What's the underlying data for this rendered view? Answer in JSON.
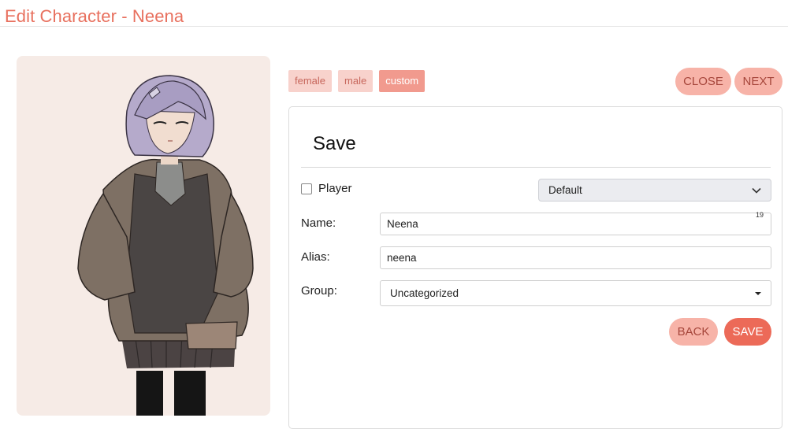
{
  "header": {
    "title": "Edit Character - Neena"
  },
  "tabs": [
    {
      "label": "female",
      "active": false
    },
    {
      "label": "male",
      "active": false
    },
    {
      "label": "custom",
      "active": true
    }
  ],
  "top_actions": {
    "close_label": "CLOSE",
    "next_label": "NEXT"
  },
  "card": {
    "title": "Save",
    "player": {
      "label": "Player",
      "checked": false
    },
    "preset_select": {
      "value": "Default"
    },
    "name": {
      "label": "Name:",
      "value": "Neena",
      "counter": "19"
    },
    "alias": {
      "label": "Alias:",
      "value": "neena"
    },
    "group": {
      "label": "Group:",
      "value": "Uncategorized"
    },
    "actions": {
      "back_label": "BACK",
      "save_label": "SAVE"
    }
  },
  "portrait": {
    "subject": "character-illustration"
  },
  "colors": {
    "accent": "#ec6a58",
    "title": "#e8705e",
    "tab_bg": "#f8d2cc",
    "tab_active_bg": "#f19a8e",
    "button_light": "#f7b3a8",
    "portrait_bg": "#f6ebe6"
  }
}
